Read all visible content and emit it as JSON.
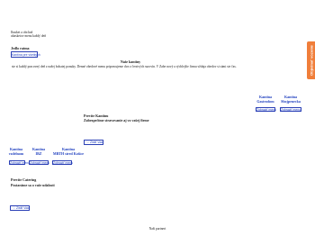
{
  "header": {
    "line1": "Ibasket a obchod",
    "line2": "ubasketov menu každý deň"
  },
  "section_top": {
    "heading": "Jedlo ratma",
    "switch_button": "Kantína pre všetkých"
  },
  "intro": {
    "title": "Naše kantíny",
    "text": "ste si každý pracovný deň z našej bohatej ponuky. Denné obedové menu pripravujeme dva z čerstvých surovín. V Zabe nový a rýchlejšie firmu vždaja obedov si sámi ste čas."
  },
  "side_tab": {
    "label": "Objednať vozenie"
  },
  "kantina_group_right": [
    {
      "name_line1": "Kantína",
      "name_line2": "Gastrodom",
      "button": "Zobraziť menu"
    },
    {
      "name_line1": "Kantína",
      "name_line2": "Sbojpenecka",
      "button": "Zobraziť menu"
    }
  ],
  "premium": {
    "title": "Prevíte Kantínu",
    "subtitle": "Zabezpečíme stravovanie aj vo vašej firme",
    "button": "Zistiť viac"
  },
  "kantina_group_left": [
    {
      "name_line1": "Kantína",
      "name_line2": "vzdelnom",
      "button": "Zobraziť menu"
    },
    {
      "name_line1": "Kantína",
      "name_line2": "IBZ",
      "button": "Zobraziť menu"
    },
    {
      "name_line1": "Kantína",
      "name_line2": "MBTH stred Košice",
      "button": "Zobraziť menu"
    }
  ],
  "catering": {
    "title": "Prevíte Catering",
    "subtitle": "Postaráme sa o vaše udalosti",
    "button": "Zistiť viac"
  },
  "footer": {
    "text": "Naši partneri"
  },
  "colors": {
    "accent": "#1f3fbf",
    "side_tab": "#f07e3a"
  }
}
